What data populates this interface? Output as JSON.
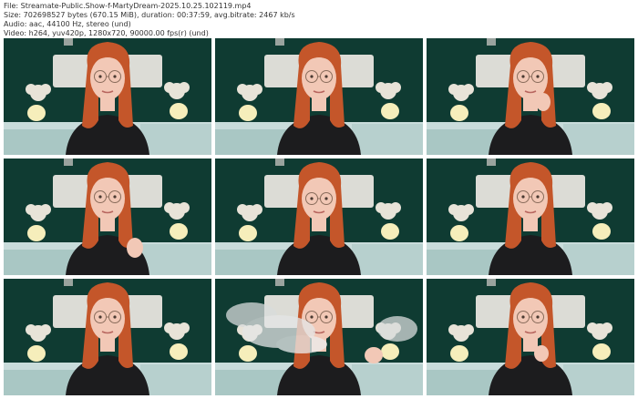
{
  "info": {
    "file_line": "File: Streamate-Public.Show-f-MartyDream-2025.10.25.102119.mp4",
    "size_line": "Size: 702698527 bytes (670.15 MiB), duration: 00:37:59, avg.bitrate: 2467 kb/s",
    "audio_line": "Audio: aac, 44100 Hz, stereo (und)",
    "video_line": "Video: h264, yuv420p, 1280x720, 90000.00 fps(r) (und)"
  },
  "colors": {
    "wall": "#0f3b32",
    "headboard": "#dcdcd6",
    "bedding": "#a9c7c4",
    "hair": "#c4562a",
    "skin": "#f2c8b6",
    "top": "#1c1c1e",
    "lamp": "#f6eebb"
  },
  "thumbnails": [
    {
      "pose": "neutral",
      "icon": "video-frame-icon"
    },
    {
      "pose": "neutral",
      "icon": "video-frame-icon"
    },
    {
      "pose": "hand-to-mouth",
      "icon": "video-frame-icon"
    },
    {
      "pose": "talking",
      "icon": "video-frame-icon"
    },
    {
      "pose": "eyes-down",
      "icon": "video-frame-icon"
    },
    {
      "pose": "neutral",
      "icon": "video-frame-icon"
    },
    {
      "pose": "neutral",
      "icon": "video-frame-icon"
    },
    {
      "pose": "vapor-cloud",
      "icon": "video-frame-icon"
    },
    {
      "pose": "hand-to-chin",
      "icon": "video-frame-icon"
    }
  ]
}
